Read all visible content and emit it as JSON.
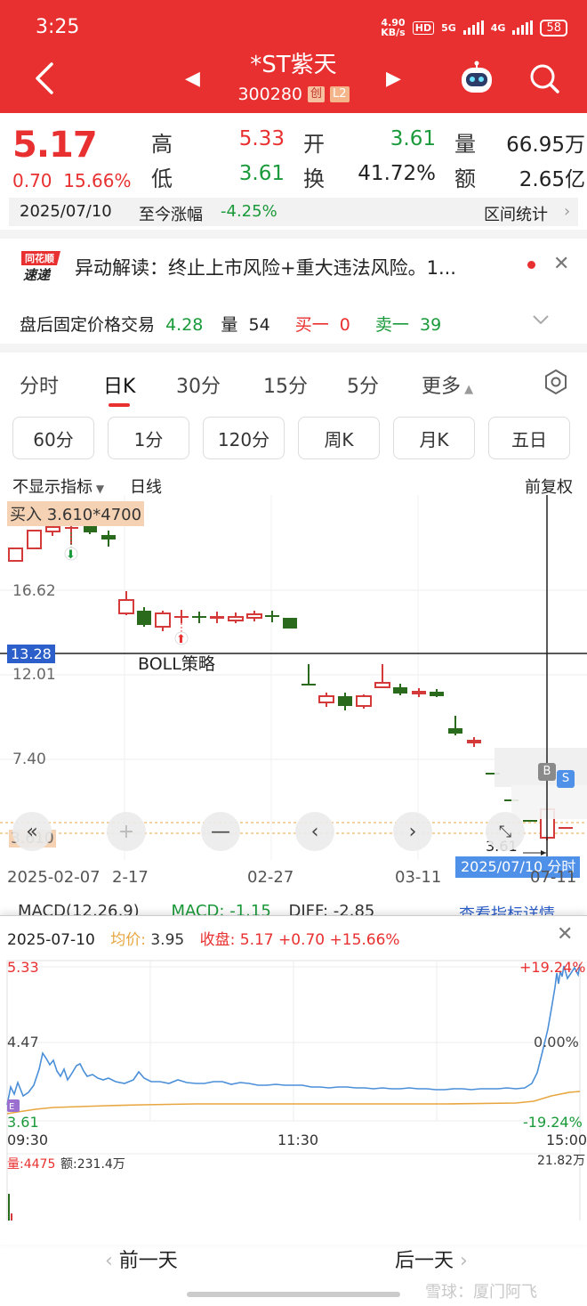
{
  "status_bar": {
    "time": "3:25",
    "speed_value": "4.90",
    "speed_unit": "KB/s",
    "hd_label": "HD",
    "net1": "5G",
    "net2": "4G",
    "battery": "58"
  },
  "header": {
    "stock_name": "*ST紫天",
    "stock_code": "300280",
    "board_tag": "创",
    "level_tag": "L2"
  },
  "quote": {
    "price": "5.17",
    "change": "0.70",
    "change_pct": "15.66%",
    "high_label": "高",
    "high": "5.33",
    "open_label": "开",
    "open": "3.61",
    "volume_label": "量",
    "volume": "66.95万",
    "low_label": "低",
    "low": "3.61",
    "turnover_label": "换",
    "turnover": "41.72%",
    "amount_label": "额",
    "amount": "2.65亿"
  },
  "date_bar": {
    "date": "2025/07/10",
    "since_label": "至今涨幅",
    "since_value": "-4.25%",
    "range_stats": "区间统计"
  },
  "news": {
    "logo_top": "同花顺",
    "logo_bottom": "速递",
    "text": "异动解读：终止上市风险+重大违法风险。1..."
  },
  "after_hours": {
    "label": "盘后固定价格交易",
    "price": "4.28",
    "vol_label": "量",
    "vol": "54",
    "bid_label": "买一",
    "bid": "0",
    "ask_label": "卖一",
    "ask": "39"
  },
  "tabs": [
    "分时",
    "日K",
    "30分",
    "15分",
    "5分",
    "更多"
  ],
  "chips": [
    "60分",
    "1分",
    "120分",
    "周K",
    "月K",
    "五日"
  ],
  "kline": {
    "indicator_toggle": "不显示指标",
    "period": "日线",
    "adjust": "前复权",
    "buy_marker": "买入  3.610*4700",
    "y_labels": [
      "16.62",
      "12.01",
      "7.40",
      "3.610"
    ],
    "crosshair_price": "13.28",
    "boll_label": "BOLL策略",
    "low_label": "3.61",
    "x_labels": [
      "2025-02-07",
      "2-17",
      "02-27",
      "03-11",
      "07-11"
    ],
    "crosshair_date": "2025/07/10  分时 >",
    "b_marker": "B",
    "s_marker": "S"
  },
  "macd": {
    "label": "MACD(12,26,9)",
    "macd": "MACD: -1.15",
    "diff": "DIFF: -2.85",
    "link": "查看指标详情"
  },
  "intraday": {
    "date": "2025-07-10",
    "avg_label": "均价:",
    "avg": "3.95",
    "close_label": "收盘:",
    "close": "5.17 +0.70 +15.66%",
    "y_high": "5.33",
    "y_mid": "4.47",
    "y_low": "3.61",
    "pct_high": "+19.24%",
    "pct_mid": "0.00%",
    "pct_low": "-19.24%",
    "t_start": "09:30",
    "t_mid": "11:30",
    "t_end": "15:00",
    "vol_text": "量:4475",
    "amt_text": "额:231.4万",
    "vol_max": "21.82万"
  },
  "bottom_nav": {
    "prev": "前一天",
    "next": "后一天"
  },
  "watermark": "雪球：厦门阿飞",
  "colors": {
    "brand_red": "#e93030",
    "up_red": "#e93030",
    "down_green": "#1a9a3a",
    "avg_orange": "#e8a640",
    "price_blue": "#4f90e8"
  }
}
